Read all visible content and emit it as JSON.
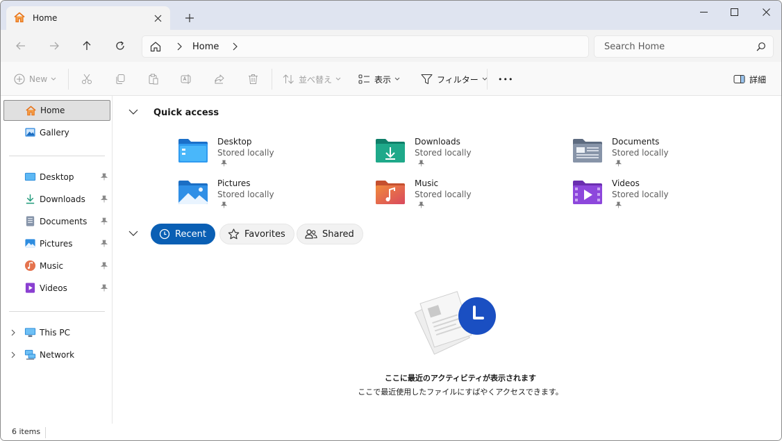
{
  "window": {
    "tab_title": "Home",
    "new_tab_symbol": "+",
    "minimize": "minimize-icon",
    "maximize": "maximize-icon",
    "close": "close-icon"
  },
  "nav": {
    "breadcrumb": "Home",
    "search_placeholder": "Search Home"
  },
  "toolbar": {
    "new_label": "New",
    "sort_label": "並べ替え",
    "view_label": "表示",
    "filter_label": "フィルター",
    "more_label": "•••",
    "details_label": "詳細"
  },
  "sidebar": {
    "home": "Home",
    "gallery": "Gallery",
    "pinned": [
      {
        "label": "Desktop",
        "icon": "desktop-icon"
      },
      {
        "label": "Downloads",
        "icon": "downloads-icon"
      },
      {
        "label": "Documents",
        "icon": "documents-icon"
      },
      {
        "label": "Pictures",
        "icon": "pictures-icon"
      },
      {
        "label": "Music",
        "icon": "music-icon"
      },
      {
        "label": "Videos",
        "icon": "videos-icon"
      }
    ],
    "this_pc": "This PC",
    "network": "Network"
  },
  "quick_access": {
    "title": "Quick access",
    "items": [
      {
        "name": "Desktop",
        "sub": "Stored locally"
      },
      {
        "name": "Downloads",
        "sub": "Stored locally"
      },
      {
        "name": "Documents",
        "sub": "Stored locally"
      },
      {
        "name": "Pictures",
        "sub": "Stored locally"
      },
      {
        "name": "Music",
        "sub": "Stored locally"
      },
      {
        "name": "Videos",
        "sub": "Stored locally"
      }
    ]
  },
  "tabs": {
    "recent": "Recent",
    "favorites": "Favorites",
    "shared": "Shared"
  },
  "empty_state": {
    "title": "ここに最近のアクティビティが表示されます",
    "subtitle": "ここで最近使用したファイルにすばやくアクセスできます。"
  },
  "status": {
    "item_count": "6 items"
  },
  "colors": {
    "accent": "#0a5fb4",
    "home_orange": "#f08a24"
  }
}
